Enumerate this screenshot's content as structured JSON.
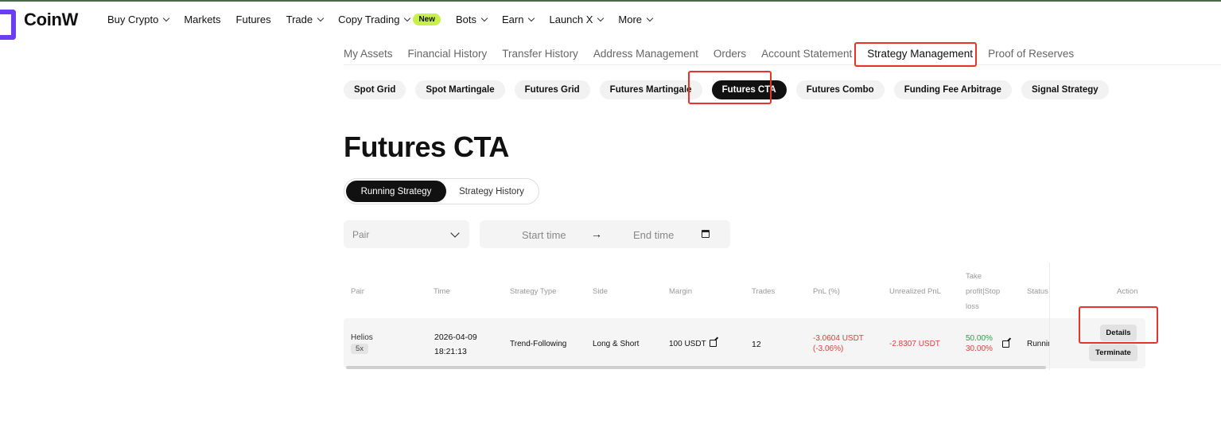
{
  "brand": {
    "name": "CoinW",
    "accent": "#6b3df5"
  },
  "nav": {
    "items": [
      {
        "label": "Buy Crypto",
        "dropdown": true
      },
      {
        "label": "Markets",
        "dropdown": false
      },
      {
        "label": "Futures",
        "dropdown": false
      },
      {
        "label": "Trade",
        "dropdown": true
      },
      {
        "label": "Copy Trading",
        "dropdown": true,
        "badge": "New"
      },
      {
        "label": "Bots",
        "dropdown": true
      },
      {
        "label": "Earn",
        "dropdown": true
      },
      {
        "label": "Launch X",
        "dropdown": true
      },
      {
        "label": "More",
        "dropdown": true
      }
    ]
  },
  "account_tabs": [
    "My Assets",
    "Financial History",
    "Transfer History",
    "Address Management",
    "Orders",
    "Account Statement",
    "Strategy Management",
    "Proof of Reserves"
  ],
  "account_tab_active": "Strategy Management",
  "strategy_pills": [
    "Spot Grid",
    "Spot Martingale",
    "Futures Grid",
    "Futures Martingale",
    "Futures CTA",
    "Futures Combo",
    "Funding Fee Arbitrage",
    "Signal Strategy"
  ],
  "strategy_pill_active": "Futures CTA",
  "page": {
    "title": "Futures CTA"
  },
  "segment": {
    "running": "Running Strategy",
    "history": "Strategy History"
  },
  "filters": {
    "pair_placeholder": "Pair",
    "start_placeholder": "Start time",
    "end_placeholder": "End time",
    "arrow": "→"
  },
  "table": {
    "headers": {
      "pair": "Pair",
      "time": "Time",
      "strategy_type": "Strategy Type",
      "side": "Side",
      "margin": "Margin",
      "trades": "Trades",
      "pnl": "PnL (%)",
      "unrealized": "Unrealized PnL",
      "tpsl": "Take profit|Stop loss",
      "status": "Status",
      "action": "Action"
    },
    "row": {
      "pair": "Helios",
      "leverage": "5x",
      "date": "2026-04-09",
      "time": "18:21:13",
      "strategy_type": "Trend-Following",
      "side": "Long & Short",
      "margin": "100 USDT",
      "trades": "12",
      "pnl_value": "-3.0604 USDT",
      "pnl_pct": "(-3.06%)",
      "unrealized": "-2.8307 USDT",
      "take_profit": "50.00%",
      "stop_loss": "30.00%",
      "status": "Runnin",
      "details": "Details",
      "terminate": "Terminate"
    }
  },
  "colors": {
    "negative": "#e0413a",
    "positive": "#26a34a",
    "highlight": "#e8332a"
  }
}
